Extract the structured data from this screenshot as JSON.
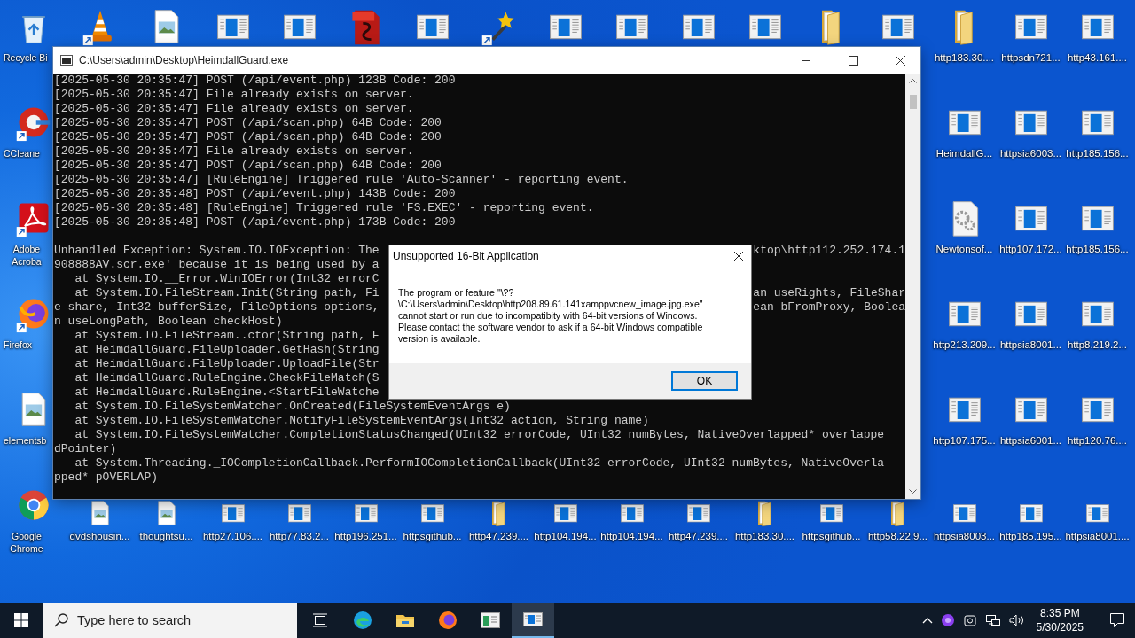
{
  "desktop": {
    "left_column": [
      {
        "kind": "recycle",
        "label": "Recycle Bi"
      },
      {
        "kind": "ccleaner",
        "label": "CCleane"
      },
      {
        "kind": "adobe",
        "label": "Adobe Acroba"
      },
      {
        "kind": "firefox",
        "label": "Firefox"
      },
      {
        "kind": "image",
        "label": "elementsb"
      },
      {
        "kind": "chrome",
        "label": "Google Chrome"
      }
    ],
    "top_row": [
      {
        "kind": "vlc"
      },
      {
        "kind": "image"
      },
      {
        "kind": "app"
      },
      {
        "kind": "app"
      },
      {
        "kind": "pdf"
      },
      {
        "kind": "app"
      },
      {
        "kind": "wand"
      },
      {
        "kind": "app"
      },
      {
        "kind": "app"
      },
      {
        "kind": "app"
      },
      {
        "kind": "app"
      },
      {
        "kind": "folder"
      },
      {
        "kind": "app"
      },
      {
        "kind": "folder",
        "label": "http183.30...."
      },
      {
        "kind": "app",
        "label": "httpsdn721..."
      },
      {
        "kind": "app",
        "label": "http43.161...."
      }
    ],
    "right_columns": [
      [
        {
          "kind": "app",
          "label": "HeimdallG..."
        },
        {
          "kind": "settings",
          "label": "Newtonsof..."
        },
        {
          "kind": "app",
          "label": "http213.209..."
        },
        {
          "kind": "app",
          "label": "http107.175..."
        }
      ],
      [
        {
          "kind": "app",
          "label": "httpsia6003..."
        },
        {
          "kind": "app",
          "label": "http107.172..."
        },
        {
          "kind": "app",
          "label": "httpsia8001..."
        },
        {
          "kind": "app",
          "label": "httpsia6001..."
        }
      ],
      [
        {
          "kind": "app",
          "label": "http185.156..."
        },
        {
          "kind": "app",
          "label": "http185.156..."
        },
        {
          "kind": "app",
          "label": "http8.219.2..."
        },
        {
          "kind": "app",
          "label": "http120.76...."
        }
      ]
    ],
    "bottom_row": [
      {
        "kind": "image",
        "label": "dvdshousin..."
      },
      {
        "kind": "image",
        "label": "thoughtsu..."
      },
      {
        "kind": "app",
        "label": "http27.106...."
      },
      {
        "kind": "app",
        "label": "http77.83.2..."
      },
      {
        "kind": "app",
        "label": "http196.251..."
      },
      {
        "kind": "app",
        "label": "httpsgithub..."
      },
      {
        "kind": "folder",
        "label": "http47.239...."
      },
      {
        "kind": "app",
        "label": "http104.194..."
      },
      {
        "kind": "app",
        "label": "http104.194..."
      },
      {
        "kind": "app",
        "label": "http47.239...."
      },
      {
        "kind": "folder",
        "label": "http183.30...."
      },
      {
        "kind": "app",
        "label": "httpsgithub..."
      },
      {
        "kind": "folder",
        "label": "http58.22.9..."
      },
      {
        "kind": "app",
        "label": "httpsia8003..."
      },
      {
        "kind": "app",
        "label": "http185.195..."
      },
      {
        "kind": "app",
        "label": "httpsia8001...."
      }
    ]
  },
  "console_window": {
    "title": "C:\\Users\\admin\\Desktop\\HeimdallGuard.exe",
    "log_lines": [
      "[2025-05-30 20:35:47] POST (/api/event.php) 123B Code: 200",
      "[2025-05-30 20:35:47] File already exists on server.",
      "[2025-05-30 20:35:47] File already exists on server.",
      "[2025-05-30 20:35:47] POST (/api/scan.php) 64B Code: 200",
      "[2025-05-30 20:35:47] POST (/api/scan.php) 64B Code: 200",
      "[2025-05-30 20:35:47] File already exists on server.",
      "[2025-05-30 20:35:47] POST (/api/scan.php) 64B Code: 200",
      "[2025-05-30 20:35:47] [RuleEngine] Triggered rule 'Auto-Scanner' - reporting event.",
      "[2025-05-30 20:35:48] POST (/api/event.php) 143B Code: 200",
      "[2025-05-30 20:35:48] [RuleEngine] Triggered rule 'FS.EXEC' - reporting event.",
      "[2025-05-30 20:35:48] POST (/api/event.php) 173B Code: 200"
    ],
    "exception_lines": [
      {
        "text": "Unhandled Exception: System.IO.IOException: The",
        "after_dialog": "ktop\\http112.252.174.1"
      },
      {
        "text": "908888AV.scr.exe' because it is being used by a"
      },
      {
        "text": "   at System.IO.__Error.WinIOError(Int32 errorC"
      },
      {
        "text": "   at System.IO.FileStream.Init(String path, Fi",
        "after_dialog": "an useRights, FileShar"
      },
      {
        "text": "e share, Int32 bufferSize, FileOptions options,",
        "after_dialog": "ean bFromProxy, Boolea"
      },
      {
        "text": "n useLongPath, Boolean checkHost)"
      },
      {
        "text": "   at System.IO.FileStream..ctor(String path, F"
      },
      {
        "text": "   at HeimdallGuard.FileUploader.GetHash(String"
      },
      {
        "text": "   at HeimdallGuard.FileUploader.UploadFile(Str"
      },
      {
        "text": "   at HeimdallGuard.RuleEngine.CheckFileMatch(S"
      },
      {
        "text": "   at HeimdallGuard.RuleEngine.<StartFileWatche"
      },
      {
        "text": "   at System.IO.FileSystemWatcher.OnCreated(FileSystemEventArgs e)"
      },
      {
        "text": "   at System.IO.FileSystemWatcher.NotifyFileSystemEventArgs(Int32 action, String name)"
      },
      {
        "text": "   at System.IO.FileSystemWatcher.CompletionStatusChanged(UInt32 errorCode, UInt32 numBytes, NativeOverlapped* overlappe"
      },
      {
        "text": "dPointer)"
      },
      {
        "text": "   at System.Threading._IOCompletionCallback.PerformIOCompletionCallback(UInt32 errorCode, UInt32 numBytes, NativeOverla"
      },
      {
        "text": "pped* pOVERLAP)"
      }
    ]
  },
  "dialog": {
    "title": "Unsupported 16-Bit Application",
    "message": "The program or feature \"\\??\\C:\\Users\\admin\\Desktop\\http208.89.61.141xamppvcnew_image.jpg.exe\" cannot start or run due to incompatibity with 64-bit versions of Windows. Please contact the software vendor to ask if a 64-bit Windows compatible version is available.",
    "button": "OK"
  },
  "taskbar": {
    "search_placeholder": "Type here to search",
    "apps": [
      {
        "kind": "edge",
        "selected": false
      },
      {
        "kind": "explorer",
        "selected": false
      },
      {
        "kind": "firefox",
        "selected": false
      },
      {
        "kind": "console",
        "selected": false
      },
      {
        "kind": "app",
        "selected": true
      }
    ],
    "time": "8:35 PM",
    "date": "5/30/2025"
  }
}
